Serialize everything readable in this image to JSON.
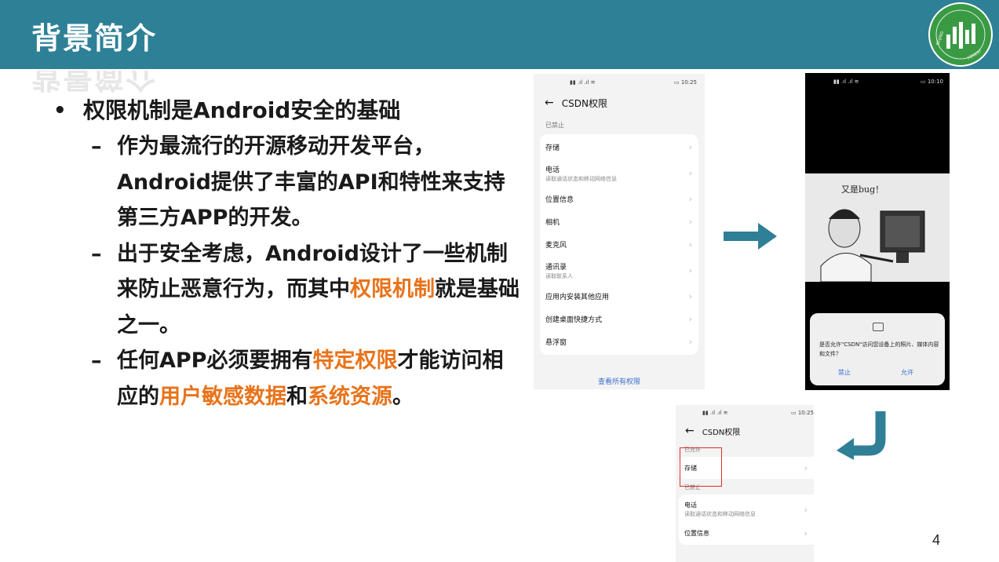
{
  "header": {
    "title": "背景简介"
  },
  "bullets": {
    "main": "权限机制是Android安全的基础",
    "sub1": "作为最流行的开源移动开发平台，Android提供了丰富的API和特性来支持第三方APP的开发。",
    "sub2_a": "出于安全考虑，Android设计了一些机制来防止恶意行为，而其中",
    "sub2_hl": "权限机制",
    "sub2_b": "就是基础之一。",
    "sub3_a": "任何APP必须要拥有",
    "sub3_hl1": "特定权限",
    "sub3_b": "才能访问相应的",
    "sub3_hl2": "用户敏感数据",
    "sub3_c": "和",
    "sub3_hl3": "系统资源",
    "sub3_d": "。"
  },
  "phone1": {
    "time": "10:25",
    "title": "CSDN权限",
    "section": "已禁止",
    "items": [
      {
        "label": "存储",
        "sub": ""
      },
      {
        "label": "电话",
        "sub": "读取通话状态和移动网络信息"
      },
      {
        "label": "位置信息",
        "sub": ""
      },
      {
        "label": "相机",
        "sub": ""
      },
      {
        "label": "麦克风",
        "sub": ""
      },
      {
        "label": "通讯录",
        "sub": "读取联系人"
      },
      {
        "label": "应用内安装其他应用",
        "sub": ""
      },
      {
        "label": "创建桌面快捷方式",
        "sub": ""
      },
      {
        "label": "悬浮窗",
        "sub": ""
      }
    ],
    "view_all": "查看所有权限"
  },
  "phone2": {
    "time": "10:10",
    "meme_caption": "又是bug！",
    "dialog_msg": "是否允许\"CSDN\"访问您设备上的照片、媒体内容和文件？",
    "deny": "禁止",
    "allow": "允许"
  },
  "phone3": {
    "time": "10:25",
    "title": "CSDN权限",
    "allowed_section": "已允许",
    "allowed_item": "存储",
    "denied_section": "已禁止",
    "denied_items": [
      {
        "label": "电话",
        "sub": "读取通话状态和移动网络信息"
      },
      {
        "label": "位置信息",
        "sub": ""
      }
    ]
  },
  "logo_text": "BEIJING FOREST STUDIO",
  "page_number": "4",
  "colors": {
    "header": "#2e8096",
    "highlight": "#e8731a",
    "logo_green": "#3a9a44",
    "arrow": "#2f7f96"
  }
}
